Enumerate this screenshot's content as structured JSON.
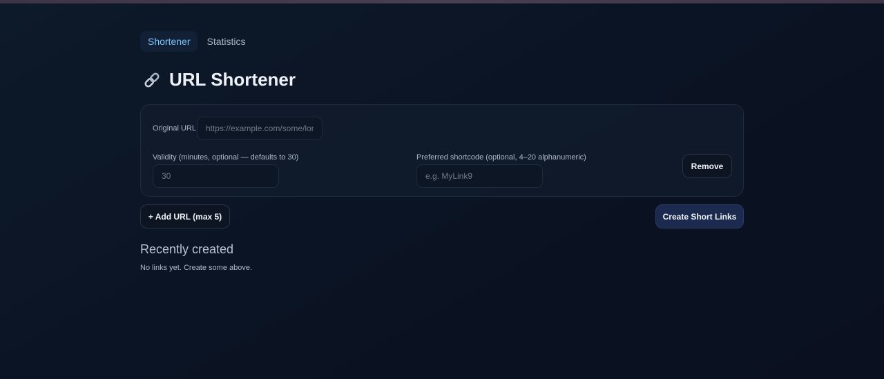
{
  "nav": {
    "tabs": [
      {
        "label": "Shortener",
        "active": true
      },
      {
        "label": "Statistics",
        "active": false
      }
    ]
  },
  "page": {
    "title": "URL Shortener",
    "title_icon": "link-icon"
  },
  "form": {
    "original_url": {
      "label": "Original URL",
      "value": "",
      "placeholder": "https://example.com/some/long/path"
    },
    "validity": {
      "label": "Validity (minutes, optional — defaults to 30)",
      "value": "",
      "placeholder": "30"
    },
    "shortcode": {
      "label": "Preferred shortcode (optional, 4–20 alphanumeric)",
      "value": "",
      "placeholder": "e.g. MyLink9"
    },
    "remove_label": "Remove"
  },
  "actions": {
    "add_label": "+ Add URL (max 5)",
    "create_label": "Create Short Links"
  },
  "recent": {
    "heading": "Recently created",
    "empty_text": "No links yet. Create some above."
  },
  "colors": {
    "background": "#0b1424",
    "accent": "#7cc4ff",
    "primary_button": "#1b2a4e"
  }
}
